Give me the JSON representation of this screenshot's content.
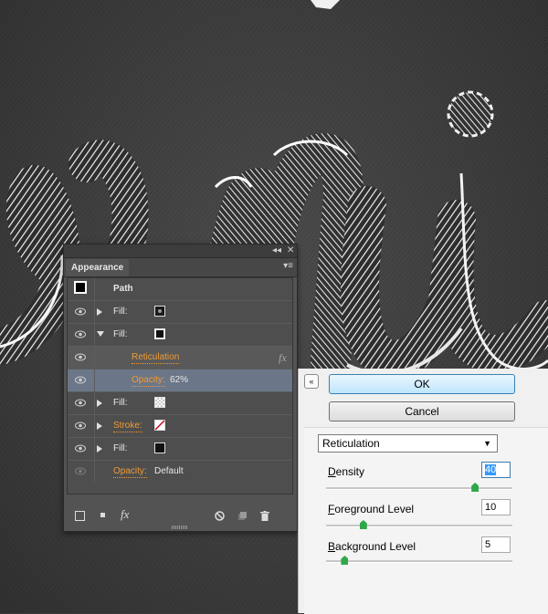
{
  "colors": {
    "accent_orange": "#f09a35",
    "selected_row": "#6b7788",
    "panel_bg": "#535353",
    "dialog_bg": "#f0f0f0",
    "chalk": "#ffffff"
  },
  "appearance_panel": {
    "title_bar": {
      "collapse_icon": "double-chevron-icon",
      "close_icon": "close-icon",
      "collapse_glyph": "◂◂",
      "close_glyph": "✕"
    },
    "tab_label": "Appearance",
    "menu_icon": "panel-menu-icon",
    "menu_glyph": "▾≡",
    "rows": [
      {
        "kind": "header",
        "label": "Path"
      },
      {
        "kind": "fill",
        "label": "Fill:",
        "expanded": false,
        "swatch": "stipple-swatch"
      },
      {
        "kind": "fill",
        "label": "Fill:",
        "expanded": true,
        "swatch": "black-swatch"
      },
      {
        "kind": "effect",
        "label": "Reticulation",
        "fx_glyph": "fx"
      },
      {
        "kind": "opacity",
        "label": "Opacity:",
        "value": "62%"
      },
      {
        "kind": "fill",
        "label": "Fill:",
        "expanded": false,
        "swatch": "checker-swatch"
      },
      {
        "kind": "stroke",
        "label": "Stroke:",
        "expanded": false,
        "swatch": "none-swatch"
      },
      {
        "kind": "fill",
        "label": "Fill:",
        "expanded": false,
        "swatch": "black-swatch"
      },
      {
        "kind": "opacity",
        "label": "Opacity:",
        "value": "Default"
      }
    ],
    "footer": {
      "fx_glyph": "fx",
      "icons": [
        "add-stroke-icon",
        "add-fill-icon",
        "fx-icon",
        "clear-appearance-icon",
        "duplicate-item-icon",
        "delete-icon"
      ]
    }
  },
  "filter_dialog": {
    "collapse_glyph": "«",
    "ok_label": "OK",
    "cancel_label": "Cancel",
    "filter_select": {
      "value": "Reticulation",
      "arrow": "▼"
    },
    "params": [
      {
        "accel": "D",
        "rest": "ensity",
        "value": "40",
        "fraction": 0.8
      },
      {
        "accel": "F",
        "rest": "oreground Level",
        "value": "10",
        "fraction": 0.2
      },
      {
        "accel": "B",
        "rest": "ackground Level",
        "value": "5",
        "fraction": 0.1
      }
    ]
  }
}
